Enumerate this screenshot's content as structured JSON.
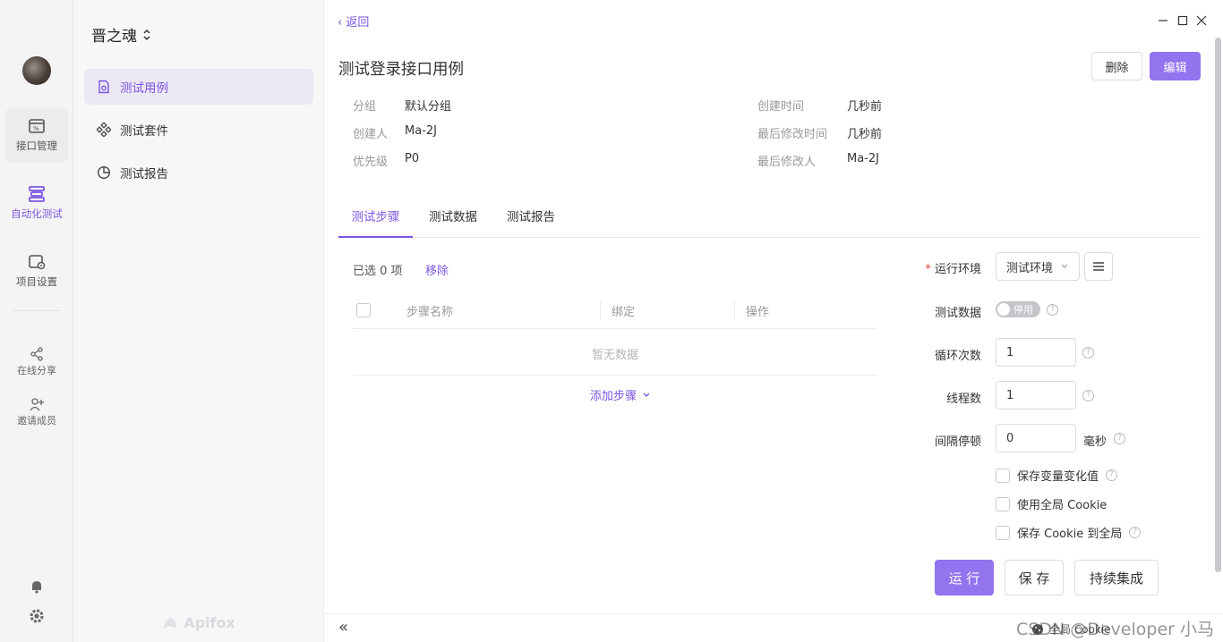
{
  "rail": {
    "items": [
      {
        "label": "接口管理"
      },
      {
        "label": "自动化测试"
      },
      {
        "label": "项目设置"
      }
    ],
    "small_items": [
      {
        "label": "在线分享"
      },
      {
        "label": "邀请成员"
      }
    ]
  },
  "sidebar": {
    "project": "晋之魂",
    "items": [
      {
        "label": "测试用例"
      },
      {
        "label": "测试套件"
      },
      {
        "label": "测试报告"
      }
    ],
    "brand": "Apifox"
  },
  "header": {
    "back": "返回",
    "title": "测试登录接口用例",
    "delete_label": "删除",
    "edit_label": "编辑"
  },
  "meta": {
    "group_label": "分组",
    "group_value": "默认分组",
    "creator_label": "创建人",
    "creator_value": "Ma-2J",
    "priority_label": "优先级",
    "priority_value": "P0",
    "created_label": "创建时间",
    "created_value": "几秒前",
    "modified_label": "最后修改时间",
    "modified_value": "几秒前",
    "modifier_label": "最后修改人",
    "modifier_value": "Ma-2J"
  },
  "tabs": [
    {
      "label": "测试步骤"
    },
    {
      "label": "测试数据"
    },
    {
      "label": "测试报告"
    }
  ],
  "steps": {
    "selected": "已选 0 项",
    "remove": "移除",
    "columns": [
      "步骤名称",
      "绑定",
      "操作"
    ],
    "empty": "暂无数据",
    "add_step": "添加步骤"
  },
  "run_panel": {
    "env_label": "运行环境",
    "env_value": "测试环境",
    "test_data_label": "测试数据",
    "test_data_toggle": "停用",
    "loops_label": "循环次数",
    "loops_value": "1",
    "threads_label": "线程数",
    "threads_value": "1",
    "interval_label": "间隔停顿",
    "interval_value": "0",
    "interval_unit": "毫秒",
    "cb_save_vars": "保存变量变化值",
    "cb_global_cookie": "使用全局 Cookie",
    "cb_save_cookie": "保存 Cookie 到全局",
    "run_label": "运 行",
    "save_label": "保 存",
    "ci_label": "持续集成"
  },
  "footer": {
    "collapse": "«",
    "status": "全局 Cookie",
    "watermark": "CSDN @Developer 小马"
  },
  "colors": {
    "accent": "#7b54e0",
    "primary_button": "#9373ee"
  }
}
